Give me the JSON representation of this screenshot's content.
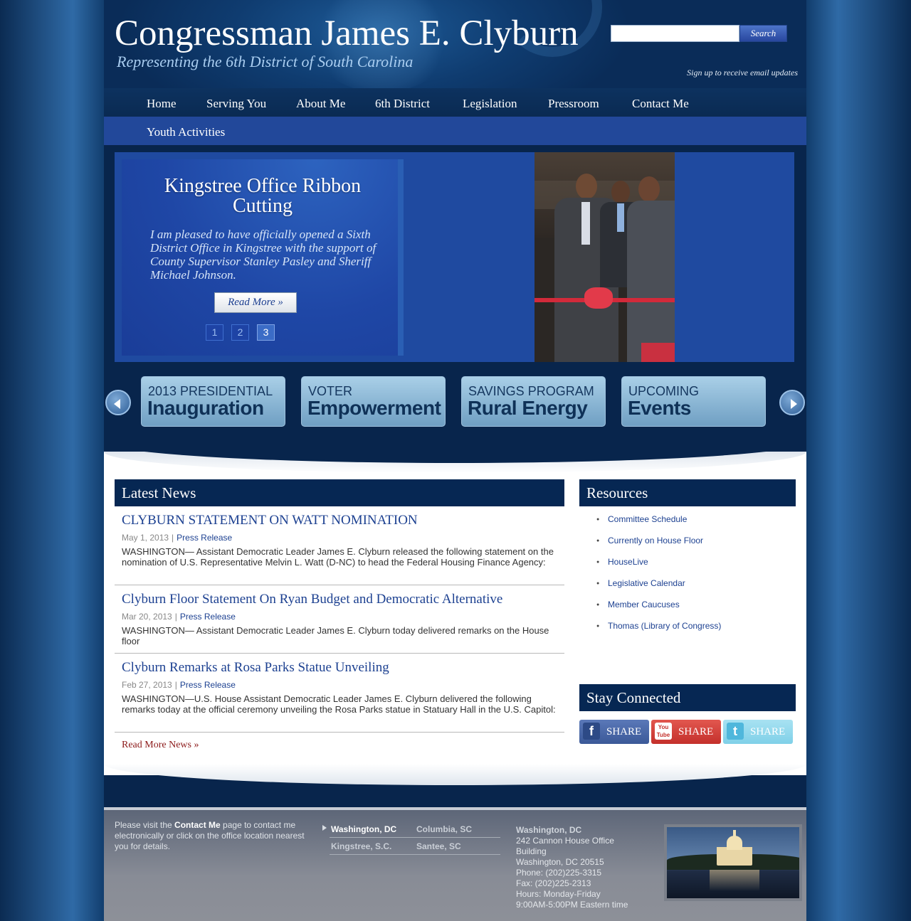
{
  "header": {
    "title": "Congressman James E. Clyburn",
    "tagline": "Representing the 6th District of South Carolina",
    "search_button_label": "Search",
    "search_value": "",
    "email_signup": "Sign up to receive email updates"
  },
  "nav": {
    "items": [
      "Home",
      "Serving You",
      "About Me",
      "6th District",
      "Legislation",
      "Pressroom",
      "Contact Me"
    ],
    "second_row_item": "Youth Activities"
  },
  "slider": {
    "title": "Kingstree Office Ribbon Cutting",
    "text": "I am pleased to have officially opened a Sixth District Office in Kingstree with the support of County Supervisor Stanley Pasley and Sheriff Michael Johnson.",
    "read_more_label": "Read More »",
    "pages": [
      "1",
      "2",
      "3"
    ],
    "active_page": "3"
  },
  "features": [
    {
      "line1": "2013 PRESIDENTIAL",
      "line2": "Inauguration"
    },
    {
      "line1": "VOTER",
      "line2": "Empowerment Act"
    },
    {
      "line1": "SAVINGS PROGRAM",
      "line2": "Rural Energy"
    },
    {
      "line1": "UPCOMING",
      "line2": "Events"
    }
  ],
  "news": {
    "heading": "Latest News",
    "items": [
      {
        "title": "CLYBURN STATEMENT ON WATT NOMINATION",
        "date": "May 1, 2013",
        "category": "Press Release",
        "body": "WASHINGTON— Assistant Democratic Leader James E. Clyburn released the following statement on the nomination of U.S. Representative Melvin L. Watt (D-NC) to head the Federal Housing Finance Agency:"
      },
      {
        "title": "Clyburn Floor Statement On Ryan Budget and Democratic Alternative",
        "date": "Mar 20, 2013",
        "category": "Press Release",
        "body": "WASHINGTON— Assistant Democratic Leader James E. Clyburn today delivered remarks on the House floor"
      },
      {
        "title": "Clyburn Remarks at Rosa Parks Statue Unveiling",
        "date": "Feb 27, 2013",
        "category": "Press Release",
        "body": "WASHINGTON—U.S. House Assistant Democratic Leader James E. Clyburn delivered the following remarks today at the official ceremony unveiling the Rosa Parks statue in Statuary Hall in the U.S. Capitol:"
      }
    ],
    "read_more": "Read More News »"
  },
  "resources": {
    "heading": "Resources",
    "items": [
      "Committee Schedule",
      "Currently on House Floor",
      "HouseLive",
      "Legislative Calendar",
      "Member Caucuses",
      "Thomas (Library of Congress)"
    ]
  },
  "stay_connected": {
    "heading": "Stay Connected",
    "buttons": [
      {
        "icon": "facebook-icon",
        "icon_glyph": "f",
        "label": "SHARE",
        "color": "#3b5998"
      },
      {
        "icon": "youtube-icon",
        "icon_glyph": "You Tube",
        "label": "SHARE",
        "color": "#c4302b"
      },
      {
        "icon": "twitter-icon",
        "icon_glyph": "t",
        "label": "SHARE",
        "color": "#7fd0e8"
      }
    ]
  },
  "footer": {
    "note_pre": "Please visit the ",
    "note_link": "Contact Me",
    "note_post": " page to contact me electronically or click on the office location nearest you for details.",
    "offices": [
      "Washington, DC",
      "Columbia, SC",
      "Kingstree, S.C.",
      "Santee, SC"
    ],
    "details": {
      "label": "Washington, DC",
      "lines": [
        "242 Cannon House Office",
        "Building",
        "Washington, DC 20515",
        "Phone: (202)225-3315",
        "Fax: (202)225-2313",
        "Hours: Monday-Friday",
        "9:00AM-5:00PM Eastern time"
      ]
    }
  }
}
